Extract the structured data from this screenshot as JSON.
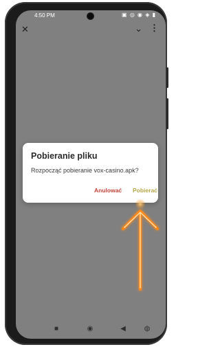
{
  "status_bar": {
    "time": "4:50 PM",
    "icons": [
      "notification-icon",
      "notification-icon",
      "notification-icon",
      "wifi-icon",
      "signal-icon",
      "battery-icon"
    ],
    "icons_text": "▣ ◎ ◉ ◈ ▮"
  },
  "top_bar": {
    "close_icon": "close-icon",
    "chevron_icon": "chevron-down-icon",
    "more_icon": "more-vert-icon"
  },
  "dialog": {
    "title": "Pobieranie pliku",
    "message": "Rozpocząć pobieranie vox-casino.apk?",
    "cancel_label": "Anulować",
    "confirm_label": "Pobierać"
  },
  "colors": {
    "screen_bg": "#808080",
    "dialog_bg": "#ffffff",
    "cancel": "#c0443b",
    "confirm": "#b7a84a",
    "arrow": "#ff8a1a"
  },
  "nav_bar": {
    "items": [
      "recents-icon",
      "home-icon",
      "back-icon",
      "accessibility-icon"
    ]
  }
}
